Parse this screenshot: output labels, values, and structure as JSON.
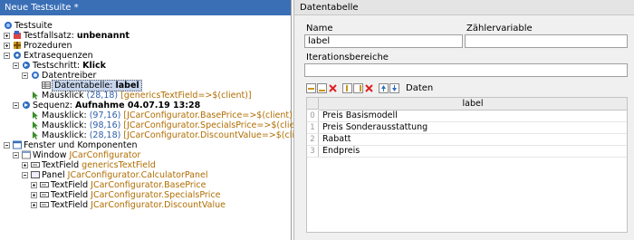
{
  "left_panel": {
    "title": "Neue Testsuite *",
    "tree": [
      {
        "text": "Testsuite"
      },
      {
        "label": "Testfallsatz: ",
        "bold": "unbenannt"
      },
      {
        "text": "Prozeduren"
      },
      {
        "text": "Extrasequenzen"
      },
      {
        "label": "Testschritt: ",
        "bold": "Klick"
      },
      {
        "text": "Datentreiber"
      },
      {
        "label": "Datentabelle: ",
        "bold": "label"
      },
      {
        "label": "Mausklick ",
        "coords": "(28,18)",
        "target": "[genericsTextField=>$(client)]"
      },
      {
        "label": "Sequenz: ",
        "bold": "Aufnahme 04.07.19 13:28"
      },
      {
        "label": "Mausklick: ",
        "coords": "(97,16)",
        "target": "[JCarConfigurator.BasePrice=>$(client)]"
      },
      {
        "label": "Mausklick: ",
        "coords": "(98,16)",
        "target": "[JCarConfigurator.SpecialsPrice=>$(client)]"
      },
      {
        "label": "Mausklick: ",
        "coords": "(28,18)",
        "target": "[JCarConfigurator.DiscountValue=>$(client)]"
      },
      {
        "text": "Fenster und Komponenten"
      },
      {
        "label": "Window ",
        "comp": "JCarConfigurator"
      },
      {
        "label": "TextField ",
        "comp": "genericsTextField"
      },
      {
        "label": "Panel ",
        "comp": "JCarConfigurator.CalculatorPanel"
      },
      {
        "label": "TextField ",
        "comp": "JCarConfigurator.BasePrice"
      },
      {
        "label": "TextField ",
        "comp": "JCarConfigurator.SpecialsPrice"
      },
      {
        "label": "TextField ",
        "comp": "JCarConfigurator.DiscountValue"
      }
    ]
  },
  "right_panel": {
    "title": "Datentabelle",
    "name_label": "Name",
    "name_value": "label",
    "counter_label": "Zählervariable",
    "counter_value": "",
    "iteration_label": "Iterationsbereiche",
    "iteration_value": "",
    "data_label": "Daten",
    "table": {
      "column": "label",
      "rows": [
        {
          "index": "0",
          "value": "Preis Basismodell"
        },
        {
          "index": "1",
          "value": "Preis Sonderausstattung"
        },
        {
          "index": "2",
          "value": "Rabatt"
        },
        {
          "index": "3",
          "value": "Endpreis"
        }
      ]
    }
  },
  "colors": {
    "header_blue": "#3a6fb6",
    "component_orange": "#b06d00",
    "selection": "#c7d6ee"
  }
}
